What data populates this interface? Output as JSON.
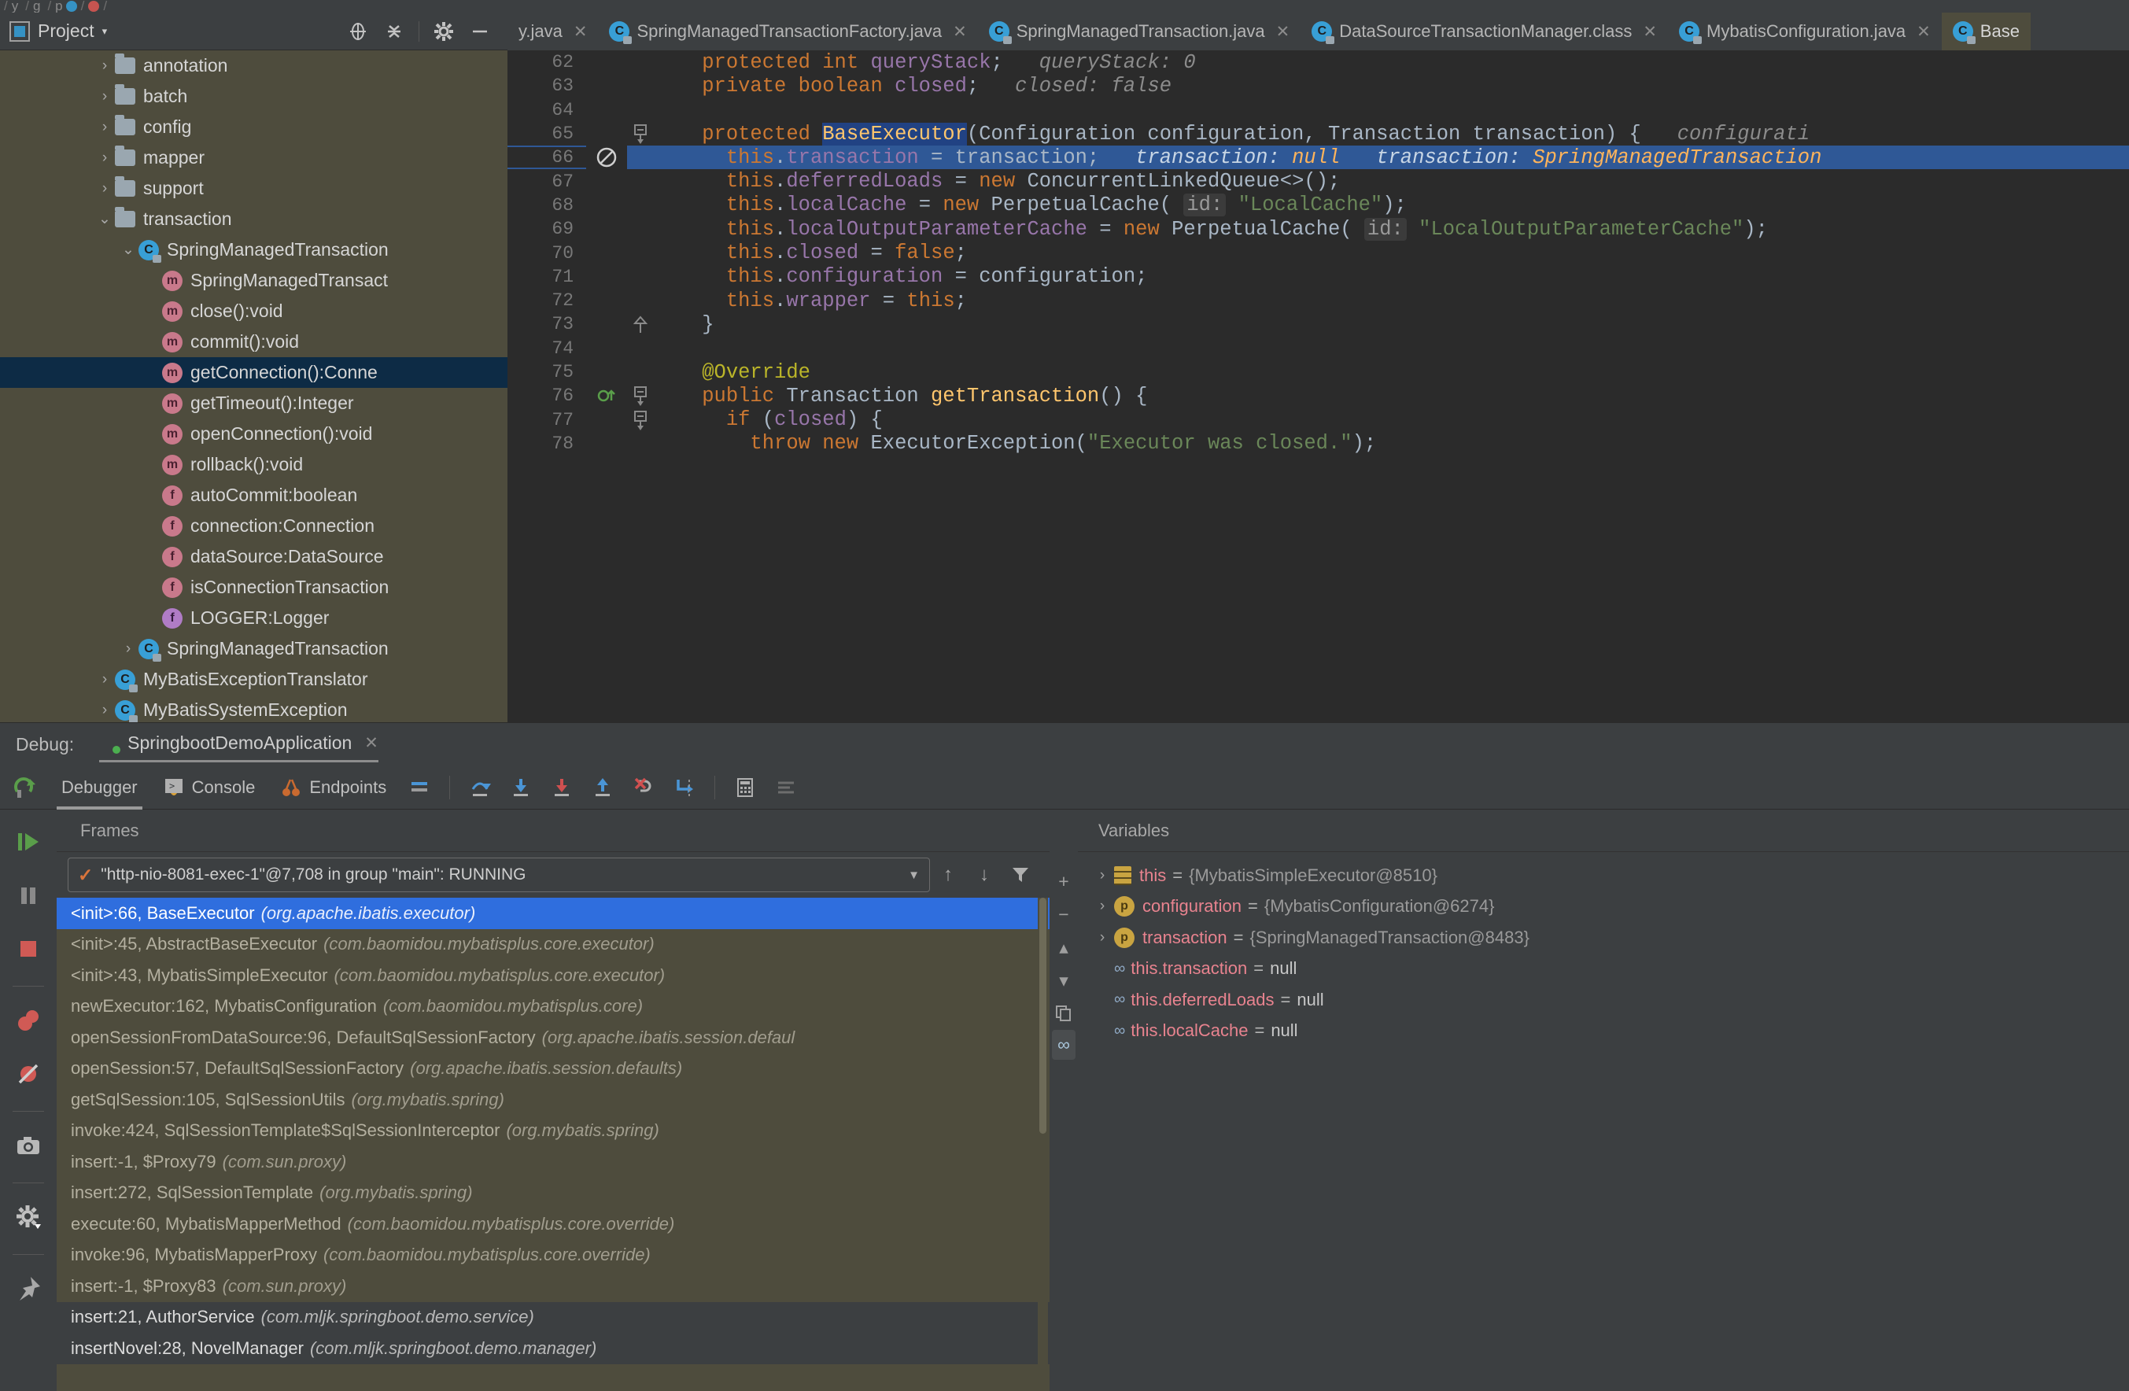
{
  "breadcrumb": [
    "y",
    "g",
    "p",
    "",
    ""
  ],
  "project_toolbar": {
    "label": "Project",
    "caret": "▾",
    "icons": [
      "locate-icon",
      "collapse-all-icon",
      "settings-gear-icon",
      "hide-icon"
    ]
  },
  "tabs": [
    {
      "label": "y.java",
      "icon": "java-class-icon",
      "active": false,
      "truncated": true
    },
    {
      "label": "SpringManagedTransactionFactory.java",
      "icon": "java-class-icon",
      "active": false
    },
    {
      "label": "SpringManagedTransaction.java",
      "icon": "java-class-icon",
      "active": false
    },
    {
      "label": "DataSourceTransactionManager.class",
      "icon": "java-class-icon",
      "active": false
    },
    {
      "label": "MybatisConfiguration.java",
      "icon": "java-class-icon",
      "active": false
    },
    {
      "label": "Base",
      "icon": "java-class-icon",
      "active": true,
      "truncated": true
    }
  ],
  "tree": [
    {
      "arrow": "›",
      "icon": "folder",
      "label": "annotation",
      "indent": 1
    },
    {
      "arrow": "›",
      "icon": "folder",
      "label": "batch",
      "indent": 1
    },
    {
      "arrow": "›",
      "icon": "folder",
      "label": "config",
      "indent": 1
    },
    {
      "arrow": "›",
      "icon": "folder",
      "label": "mapper",
      "indent": 1
    },
    {
      "arrow": "›",
      "icon": "folder",
      "label": "support",
      "indent": 1
    },
    {
      "arrow": "⌄",
      "icon": "folder",
      "label": "transaction",
      "indent": 1
    },
    {
      "arrow": "⌄",
      "icon": "class",
      "label": "SpringManagedTransaction",
      "indent": 2
    },
    {
      "arrow": "",
      "icon": "method",
      "label": "SpringManagedTransact",
      "indent": 3
    },
    {
      "arrow": "",
      "icon": "method",
      "label": "close():void",
      "indent": 3
    },
    {
      "arrow": "",
      "icon": "method",
      "label": "commit():void",
      "indent": 3
    },
    {
      "arrow": "",
      "icon": "method",
      "label": "getConnection():Conne",
      "indent": 3,
      "selected": true
    },
    {
      "arrow": "",
      "icon": "method",
      "label": "getTimeout():Integer",
      "indent": 3
    },
    {
      "arrow": "",
      "icon": "method",
      "label": "openConnection():void",
      "indent": 3
    },
    {
      "arrow": "",
      "icon": "method",
      "label": "rollback():void",
      "indent": 3
    },
    {
      "arrow": "",
      "icon": "field",
      "label": "autoCommit:boolean",
      "indent": 3
    },
    {
      "arrow": "",
      "icon": "field",
      "label": "connection:Connection",
      "indent": 3
    },
    {
      "arrow": "",
      "icon": "field",
      "label": "dataSource:DataSource",
      "indent": 3
    },
    {
      "arrow": "",
      "icon": "field",
      "label": "isConnectionTransaction",
      "indent": 3
    },
    {
      "arrow": "",
      "icon": "field-static",
      "label": "LOGGER:Logger",
      "indent": 3
    },
    {
      "arrow": "›",
      "icon": "class",
      "label": "SpringManagedTransaction",
      "indent": 2
    },
    {
      "arrow": "›",
      "icon": "class",
      "label": "MyBatisExceptionTranslator",
      "indent": 1
    },
    {
      "arrow": "›",
      "icon": "class",
      "label": "MyBatisSystemException",
      "indent": 1
    }
  ],
  "editor": {
    "lines": [
      {
        "num": "62",
        "highlight": false,
        "fold": "",
        "mark": "",
        "tokens": [
          {
            "t": "    ",
            "c": "id"
          },
          {
            "t": "protected ",
            "c": "kw"
          },
          {
            "t": "int ",
            "c": "kw"
          },
          {
            "t": "queryStack",
            "c": "fld"
          },
          {
            "t": ";",
            "c": "id"
          },
          {
            "t": "   queryStack: ",
            "c": "hint"
          },
          {
            "t": "0",
            "c": "hint"
          }
        ]
      },
      {
        "num": "63",
        "highlight": false,
        "fold": "",
        "mark": "",
        "tokens": [
          {
            "t": "    ",
            "c": "id"
          },
          {
            "t": "private ",
            "c": "kw"
          },
          {
            "t": "boolean ",
            "c": "kw"
          },
          {
            "t": "closed",
            "c": "fld"
          },
          {
            "t": ";",
            "c": "id"
          },
          {
            "t": "   closed: ",
            "c": "hint"
          },
          {
            "t": "false",
            "c": "hint"
          }
        ]
      },
      {
        "num": "64",
        "highlight": false,
        "fold": "",
        "mark": "",
        "tokens": []
      },
      {
        "num": "65",
        "highlight": false,
        "fold": "⊟",
        "mark": "",
        "tokens": [
          {
            "t": "    ",
            "c": "id"
          },
          {
            "t": "protected ",
            "c": "kw"
          },
          {
            "t": "BaseExecutor",
            "c": "meth selbox"
          },
          {
            "t": "(Configuration configuration, Transaction transaction) {",
            "c": "id"
          },
          {
            "t": "   configurati",
            "c": "hint"
          }
        ]
      },
      {
        "num": "66",
        "highlight": true,
        "fold": "",
        "mark": "⊘",
        "tokens": [
          {
            "t": "      ",
            "c": "id"
          },
          {
            "t": "this",
            "c": "kw"
          },
          {
            "t": ".",
            "c": "id"
          },
          {
            "t": "transaction",
            "c": "fld"
          },
          {
            "t": " = transaction;",
            "c": "id"
          },
          {
            "t": "   transaction: ",
            "c": "hint"
          },
          {
            "t": "null",
            "c": "hintv"
          },
          {
            "t": "   transaction: ",
            "c": "hint"
          },
          {
            "t": "SpringManagedTransaction",
            "c": "hintv"
          }
        ]
      },
      {
        "num": "67",
        "highlight": false,
        "fold": "",
        "mark": "",
        "tokens": [
          {
            "t": "      ",
            "c": "id"
          },
          {
            "t": "this",
            "c": "kw"
          },
          {
            "t": ".",
            "c": "id"
          },
          {
            "t": "deferredLoads",
            "c": "fld"
          },
          {
            "t": " = ",
            "c": "id"
          },
          {
            "t": "new ",
            "c": "kw"
          },
          {
            "t": "ConcurrentLinkedQueue<>();",
            "c": "id"
          }
        ]
      },
      {
        "num": "68",
        "highlight": false,
        "fold": "",
        "mark": "",
        "tokens": [
          {
            "t": "      ",
            "c": "id"
          },
          {
            "t": "this",
            "c": "kw"
          },
          {
            "t": ".",
            "c": "id"
          },
          {
            "t": "localCache",
            "c": "fld"
          },
          {
            "t": " = ",
            "c": "id"
          },
          {
            "t": "new ",
            "c": "kw"
          },
          {
            "t": "PerpetualCache( ",
            "c": "id"
          },
          {
            "t": "id:",
            "c": "chip"
          },
          {
            "t": " ",
            "c": "id"
          },
          {
            "t": "\"LocalCache\"",
            "c": "str"
          },
          {
            "t": ");",
            "c": "id"
          }
        ]
      },
      {
        "num": "69",
        "highlight": false,
        "fold": "",
        "mark": "",
        "tokens": [
          {
            "t": "      ",
            "c": "id"
          },
          {
            "t": "this",
            "c": "kw"
          },
          {
            "t": ".",
            "c": "id"
          },
          {
            "t": "localOutputParameterCache",
            "c": "fld"
          },
          {
            "t": " = ",
            "c": "id"
          },
          {
            "t": "new ",
            "c": "kw"
          },
          {
            "t": "PerpetualCache( ",
            "c": "id"
          },
          {
            "t": "id:",
            "c": "chip"
          },
          {
            "t": " ",
            "c": "id"
          },
          {
            "t": "\"LocalOutputParameterCache\"",
            "c": "str"
          },
          {
            "t": ");",
            "c": "id"
          }
        ]
      },
      {
        "num": "70",
        "highlight": false,
        "fold": "",
        "mark": "",
        "tokens": [
          {
            "t": "      ",
            "c": "id"
          },
          {
            "t": "this",
            "c": "kw"
          },
          {
            "t": ".",
            "c": "id"
          },
          {
            "t": "closed",
            "c": "fld"
          },
          {
            "t": " = ",
            "c": "id"
          },
          {
            "t": "false",
            "c": "kw"
          },
          {
            "t": ";",
            "c": "id"
          }
        ]
      },
      {
        "num": "71",
        "highlight": false,
        "fold": "",
        "mark": "",
        "tokens": [
          {
            "t": "      ",
            "c": "id"
          },
          {
            "t": "this",
            "c": "kw"
          },
          {
            "t": ".",
            "c": "id"
          },
          {
            "t": "configuration",
            "c": "fld"
          },
          {
            "t": " = configuration;",
            "c": "id"
          }
        ]
      },
      {
        "num": "72",
        "highlight": false,
        "fold": "",
        "mark": "",
        "tokens": [
          {
            "t": "      ",
            "c": "id"
          },
          {
            "t": "this",
            "c": "kw"
          },
          {
            "t": ".",
            "c": "id"
          },
          {
            "t": "wrapper",
            "c": "fld"
          },
          {
            "t": " = ",
            "c": "id"
          },
          {
            "t": "this",
            "c": "kw"
          },
          {
            "t": ";",
            "c": "id"
          }
        ]
      },
      {
        "num": "73",
        "highlight": false,
        "fold": "⌂",
        "mark": "",
        "tokens": [
          {
            "t": "    }",
            "c": "id"
          }
        ]
      },
      {
        "num": "74",
        "highlight": false,
        "fold": "",
        "mark": "",
        "tokens": []
      },
      {
        "num": "75",
        "highlight": false,
        "fold": "",
        "mark": "",
        "tokens": [
          {
            "t": "    ",
            "c": "id"
          },
          {
            "t": "@Override",
            "c": "anno"
          }
        ]
      },
      {
        "num": "76",
        "highlight": false,
        "fold": "⊟",
        "mark": "⊙↑",
        "tokens": [
          {
            "t": "    ",
            "c": "id"
          },
          {
            "t": "public ",
            "c": "kw"
          },
          {
            "t": "Transaction ",
            "c": "id"
          },
          {
            "t": "getTransaction",
            "c": "meth"
          },
          {
            "t": "() {",
            "c": "id"
          }
        ]
      },
      {
        "num": "77",
        "highlight": false,
        "fold": "⊟",
        "mark": "",
        "tokens": [
          {
            "t": "      ",
            "c": "id"
          },
          {
            "t": "if ",
            "c": "kw"
          },
          {
            "t": "(",
            "c": "id"
          },
          {
            "t": "closed",
            "c": "fld"
          },
          {
            "t": ") {",
            "c": "id"
          }
        ]
      },
      {
        "num": "78",
        "highlight": false,
        "fold": "",
        "mark": "",
        "tokens": [
          {
            "t": "        ",
            "c": "id"
          },
          {
            "t": "throw ",
            "c": "kw"
          },
          {
            "t": "new ",
            "c": "kw"
          },
          {
            "t": "ExecutorException(",
            "c": "id"
          },
          {
            "t": "\"Executor was closed.\"",
            "c": "str"
          },
          {
            "t": ");",
            "c": "id"
          }
        ]
      }
    ]
  },
  "debug": {
    "label": "Debug:",
    "config_name": "SpringbootDemoApplication",
    "close": "✕",
    "tabs": [
      {
        "label": "Debugger",
        "icon": "",
        "active": true
      },
      {
        "label": "Console",
        "icon": "console-icon",
        "active": false
      },
      {
        "label": "Endpoints",
        "icon": "endpoints-icon",
        "active": false
      }
    ],
    "toolbar_icons": [
      "layout-icon",
      "step-over-icon",
      "step-into-icon",
      "force-step-into-icon",
      "step-out-icon",
      "drop-frame-icon",
      "run-to-cursor-icon",
      "evaluate-expression-icon",
      "trace-icon"
    ],
    "left_icons": [
      "resume-program-icon",
      "pause-program-icon",
      "stop-icon",
      "view-breakpoints-icon",
      "mute-breakpoints-icon",
      "snapshot-icon",
      "settings-gear-icon",
      "pin-icon"
    ]
  },
  "frames": {
    "title": "Frames",
    "thread": "\"http-nio-8081-exec-1\"@7,708 in group \"main\": RUNNING",
    "thread_state_check": "✓",
    "buttons": [
      "frame-up-icon",
      "frame-down-icon",
      "filter-icon"
    ],
    "items": [
      {
        "main": "<init>:66, BaseExecutor",
        "pkg": "(org.apache.ibatis.executor)",
        "selected": true
      },
      {
        "main": "<init>:45, AbstractBaseExecutor",
        "pkg": "(com.baomidou.mybatisplus.core.executor)"
      },
      {
        "main": "<init>:43, MybatisSimpleExecutor",
        "pkg": "(com.baomidou.mybatisplus.core.executor)"
      },
      {
        "main": "newExecutor:162, MybatisConfiguration",
        "pkg": "(com.baomidou.mybatisplus.core)"
      },
      {
        "main": "openSessionFromDataSource:96, DefaultSqlSessionFactory",
        "pkg": "(org.apache.ibatis.session.defaul"
      },
      {
        "main": "openSession:57, DefaultSqlSessionFactory",
        "pkg": "(org.apache.ibatis.session.defaults)"
      },
      {
        "main": "getSqlSession:105, SqlSessionUtils",
        "pkg": "(org.mybatis.spring)"
      },
      {
        "main": "invoke:424, SqlSessionTemplate$SqlSessionInterceptor",
        "pkg": "(org.mybatis.spring)"
      },
      {
        "main": "insert:-1, $Proxy79",
        "pkg": "(com.sun.proxy)"
      },
      {
        "main": "insert:272, SqlSessionTemplate",
        "pkg": "(org.mybatis.spring)"
      },
      {
        "main": "execute:60, MybatisMapperMethod",
        "pkg": "(com.baomidou.mybatisplus.core.override)"
      },
      {
        "main": "invoke:96, MybatisMapperProxy",
        "pkg": "(com.baomidou.mybatisplus.core.override)"
      },
      {
        "main": "insert:-1, $Proxy83",
        "pkg": "(com.sun.proxy)"
      },
      {
        "main": "insert:21, AuthorService",
        "pkg": "(com.mljk.springboot.demo.service)",
        "plain": true
      },
      {
        "main": "insertNovel:28, NovelManager",
        "pkg": "(com.mljk.springboot.demo.manager)",
        "plain": true
      }
    ]
  },
  "variables": {
    "title": "Variables",
    "buttons": [
      "add-watch-icon",
      "remove-watch-icon",
      "up-icon",
      "down-icon",
      "copy-icon",
      "watches-icon"
    ],
    "items": [
      {
        "tri": "›",
        "icon": "this-icon",
        "name": "this",
        "value": "{MybatisSimpleExecutor@8510}"
      },
      {
        "tri": "›",
        "icon": "param-icon",
        "name": "configuration",
        "value": "{MybatisConfiguration@6274}"
      },
      {
        "tri": "›",
        "icon": "param-icon",
        "name": "transaction",
        "value": "{SpringManagedTransaction@8483}"
      },
      {
        "tri": "",
        "icon": "watch-icon",
        "name": "this.transaction",
        "value": "null"
      },
      {
        "tri": "",
        "icon": "watch-icon",
        "name": "this.deferredLoads",
        "value": "null"
      },
      {
        "tri": "",
        "icon": "watch-icon",
        "name": "this.localCache",
        "value": "null"
      }
    ]
  },
  "colors": {
    "tree_bg": "#4e4c3d",
    "editor_bg": "#2b2b2b",
    "panel_bg": "#3c3f41",
    "selection_blue": "#2f6ede",
    "exec_line_blue": "#2f5896",
    "keyword_orange": "#cc7832",
    "field_purple": "#9876aa",
    "string_green": "#6a8759",
    "method_yellow": "#ffc66d"
  }
}
